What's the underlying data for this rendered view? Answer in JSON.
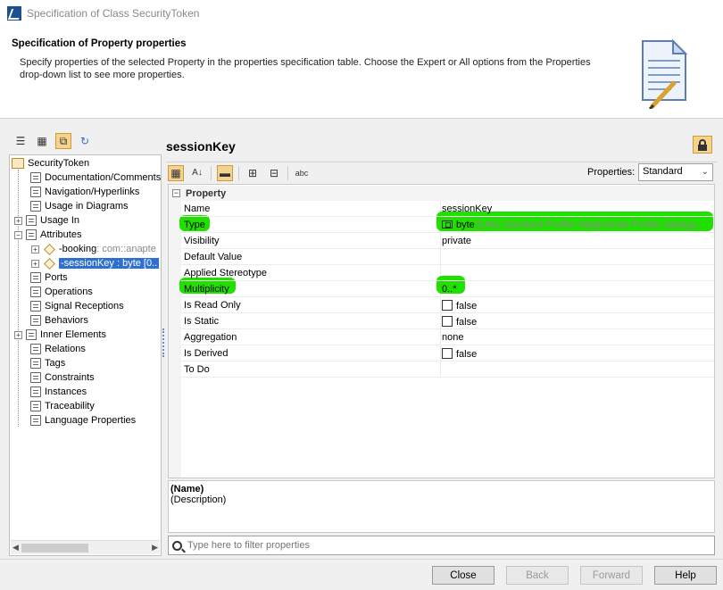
{
  "window": {
    "title": "Specification of Class SecurityToken"
  },
  "banner": {
    "heading": "Specification of Property properties",
    "description": "Specify properties of the selected Property in the properties specification table. Choose the Expert or All options from the Properties drop-down list to see more properties."
  },
  "tree": {
    "root": "SecurityToken",
    "items": [
      {
        "label": "Documentation/Comments",
        "expandable": false
      },
      {
        "label": "Navigation/Hyperlinks",
        "expandable": false
      },
      {
        "label": "Usage in Diagrams",
        "expandable": false
      },
      {
        "label": "Usage In",
        "expandable": true
      },
      {
        "label": "Attributes",
        "expandable": true,
        "expanded": true
      },
      {
        "label": "Ports",
        "expandable": false
      },
      {
        "label": "Operations",
        "expandable": false
      },
      {
        "label": "Signal Receptions",
        "expandable": false
      },
      {
        "label": "Behaviors",
        "expandable": false
      },
      {
        "label": "Inner Elements",
        "expandable": true
      },
      {
        "label": "Relations",
        "expandable": false
      },
      {
        "label": "Tags",
        "expandable": false
      },
      {
        "label": "Constraints",
        "expandable": false
      },
      {
        "label": "Instances",
        "expandable": false
      },
      {
        "label": "Traceability",
        "expandable": false
      },
      {
        "label": "Language Properties",
        "expandable": false
      }
    ],
    "attributes": [
      {
        "name": "-booking",
        "type": " : com::anapte",
        "selected": false
      },
      {
        "name": "-sessionKey : byte [0..",
        "type": "",
        "selected": true
      }
    ]
  },
  "element": {
    "name": "sessionKey"
  },
  "toolbar": {
    "properties_label": "Properties:",
    "properties_value": "Standard",
    "abc_label": "abc"
  },
  "grid": {
    "group": "Property",
    "rows": [
      {
        "key": "Name",
        "value": "sessionKey"
      },
      {
        "key": "Type",
        "value": "byte",
        "value_extra": " [UML Standard Profile::MagicDraw Profile::datatyp...",
        "highlight": true
      },
      {
        "key": "Visibility",
        "value": "private"
      },
      {
        "key": "Default Value",
        "value": ""
      },
      {
        "key": "Applied Stereotype",
        "value": ""
      },
      {
        "key": "Multiplicity",
        "value": "0..*",
        "highlight": true
      },
      {
        "key": "Is Read Only",
        "value": "false",
        "checkbox": true
      },
      {
        "key": "Is Static",
        "value": "false",
        "checkbox": true
      },
      {
        "key": "Aggregation",
        "value": "none"
      },
      {
        "key": "Is Derived",
        "value": "false",
        "checkbox": true
      },
      {
        "key": "To Do",
        "value": ""
      }
    ]
  },
  "description_panel": {
    "name": "(Name)",
    "text": "(Description)"
  },
  "filter": {
    "placeholder": "Type here to filter properties"
  },
  "buttons": {
    "close": "Close",
    "back": "Back",
    "forward": "Forward",
    "help": "Help"
  },
  "colors": {
    "highlight": "#20e000",
    "selection": "#2f6fd0",
    "active_toggle": "#f6d28f"
  }
}
